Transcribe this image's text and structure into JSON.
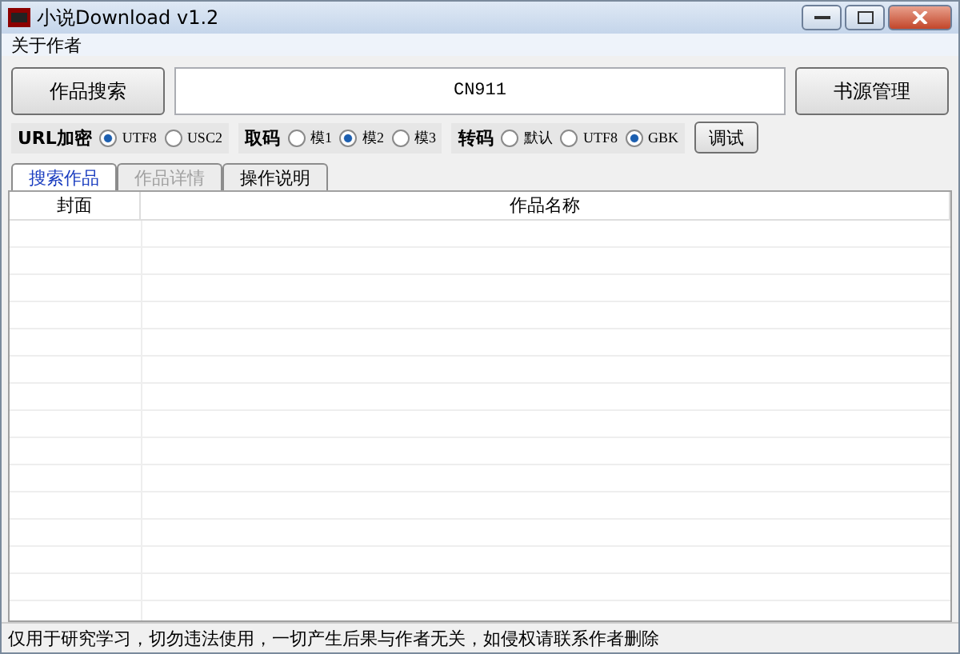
{
  "window": {
    "title": "小说Download v1.2"
  },
  "menu": [
    "关于作者"
  ],
  "search_button": "作品搜索",
  "search_field": {
    "value": "CN911"
  },
  "manage_button": "书源管理",
  "option_groups": [
    {
      "label": "URL加密",
      "options": [
        {
          "label": "UTF8",
          "selected": true
        },
        {
          "label": "USC2",
          "selected": false
        }
      ]
    },
    {
      "label": "取码",
      "options": [
        {
          "label": "模1",
          "selected": false
        },
        {
          "label": "模2",
          "selected": true
        },
        {
          "label": "模3",
          "selected": false
        }
      ]
    },
    {
      "label": "转码",
      "options": [
        {
          "label": "默认",
          "selected": false
        },
        {
          "label": "UTF8",
          "selected": false
        },
        {
          "label": "GBK",
          "selected": true
        }
      ]
    }
  ],
  "debug_button": "调试",
  "tabs": [
    {
      "label": "搜索作品",
      "selected": true,
      "disabled": false
    },
    {
      "label": "作品详情",
      "selected": false,
      "disabled": true
    },
    {
      "label": "操作说明",
      "selected": false,
      "disabled": false
    }
  ],
  "table": {
    "columns": [
      "封面",
      "作品名称"
    ]
  },
  "status_bar": "仅用于研究学习，切勿违法使用，一切产生后果与作者无关，如侵权请联系作者删除"
}
